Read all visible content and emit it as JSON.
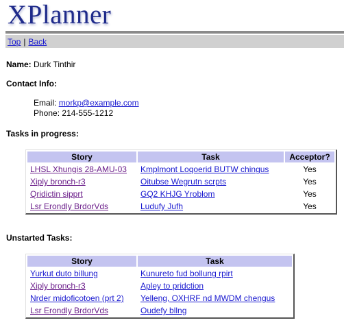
{
  "app": {
    "title": "XPlanner"
  },
  "nav": {
    "top": "Top",
    "separator": "|",
    "back": "Back"
  },
  "person": {
    "name_label": "Name:",
    "name": "Durk Tinthir",
    "contact_label": "Contact Info:",
    "email_label": "Email:",
    "email": "morkp@example.com",
    "phone_label": "Phone:",
    "phone": "214-555-1212"
  },
  "in_progress": {
    "heading": "Tasks in progress:",
    "columns": [
      "Story",
      "Task",
      "Acceptor?"
    ],
    "rows": [
      {
        "story": "LHSL Xhungis 28-AMU-03",
        "task": "Kmplmont Loqoerid BUTW chingus",
        "acceptor": "Yes"
      },
      {
        "story": "Xiply bronch-r3",
        "task": "Oitubse Wegrutn scrpts",
        "acceptor": "Yes"
      },
      {
        "story": "Qridictin sipprt",
        "task": "GQ2 KHJG Yroblom",
        "acceptor": "Yes"
      },
      {
        "story": "Lsr Erondly BrdorVds",
        "task": "Ludufy Jufh",
        "acceptor": "Yes"
      }
    ]
  },
  "unstarted": {
    "heading": "Unstarted Tasks:",
    "columns": [
      "Story",
      "Task"
    ],
    "rows": [
      {
        "story": "Yurkut duto billung",
        "task": "Kunureto fud bollung rpirt"
      },
      {
        "story": "Xiply bronch-r3",
        "task": "Apley to pridction"
      },
      {
        "story": "Nrder midoficotoen (prt 2)",
        "task": "Yelleng, OXHRF nd MWDM chengus"
      },
      {
        "story": "Lsr Erondly BrdorVds",
        "task": "Oudefy bllng"
      }
    ]
  },
  "colors": {
    "header_bg": "#c4c4f0",
    "link": "#1a1ad0",
    "visited": "#6b1e8a",
    "logo": "#1e2a8a"
  }
}
